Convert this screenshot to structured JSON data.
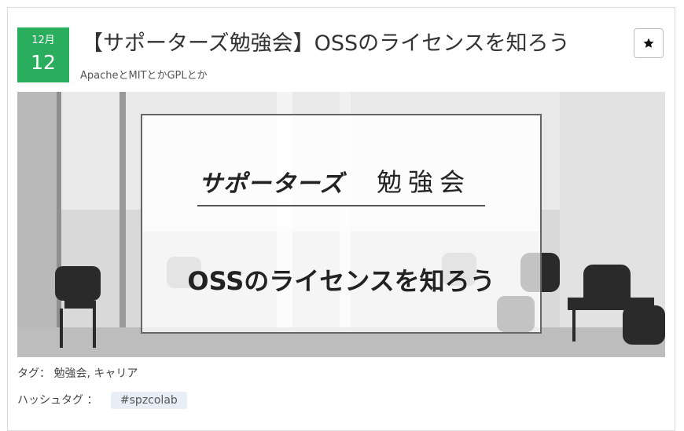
{
  "event": {
    "date": {
      "month": "12月",
      "day": "12"
    },
    "title": "【サポーターズ勉強会】OSSのライセンスを知ろう",
    "subtitle": "ApacheとMITとかGPLとか",
    "bookmark_icon": "star-icon"
  },
  "hero": {
    "brand": "サポーターズ",
    "brand_suffix": "勉強会",
    "headline": "OSSのライセンスを知ろう"
  },
  "meta": {
    "tags_label": "タグ：",
    "tags": [
      "勉強会",
      "キャリア"
    ],
    "hashtag_label": "ハッシュタグ ：",
    "hashtag": "#spzcolab"
  }
}
